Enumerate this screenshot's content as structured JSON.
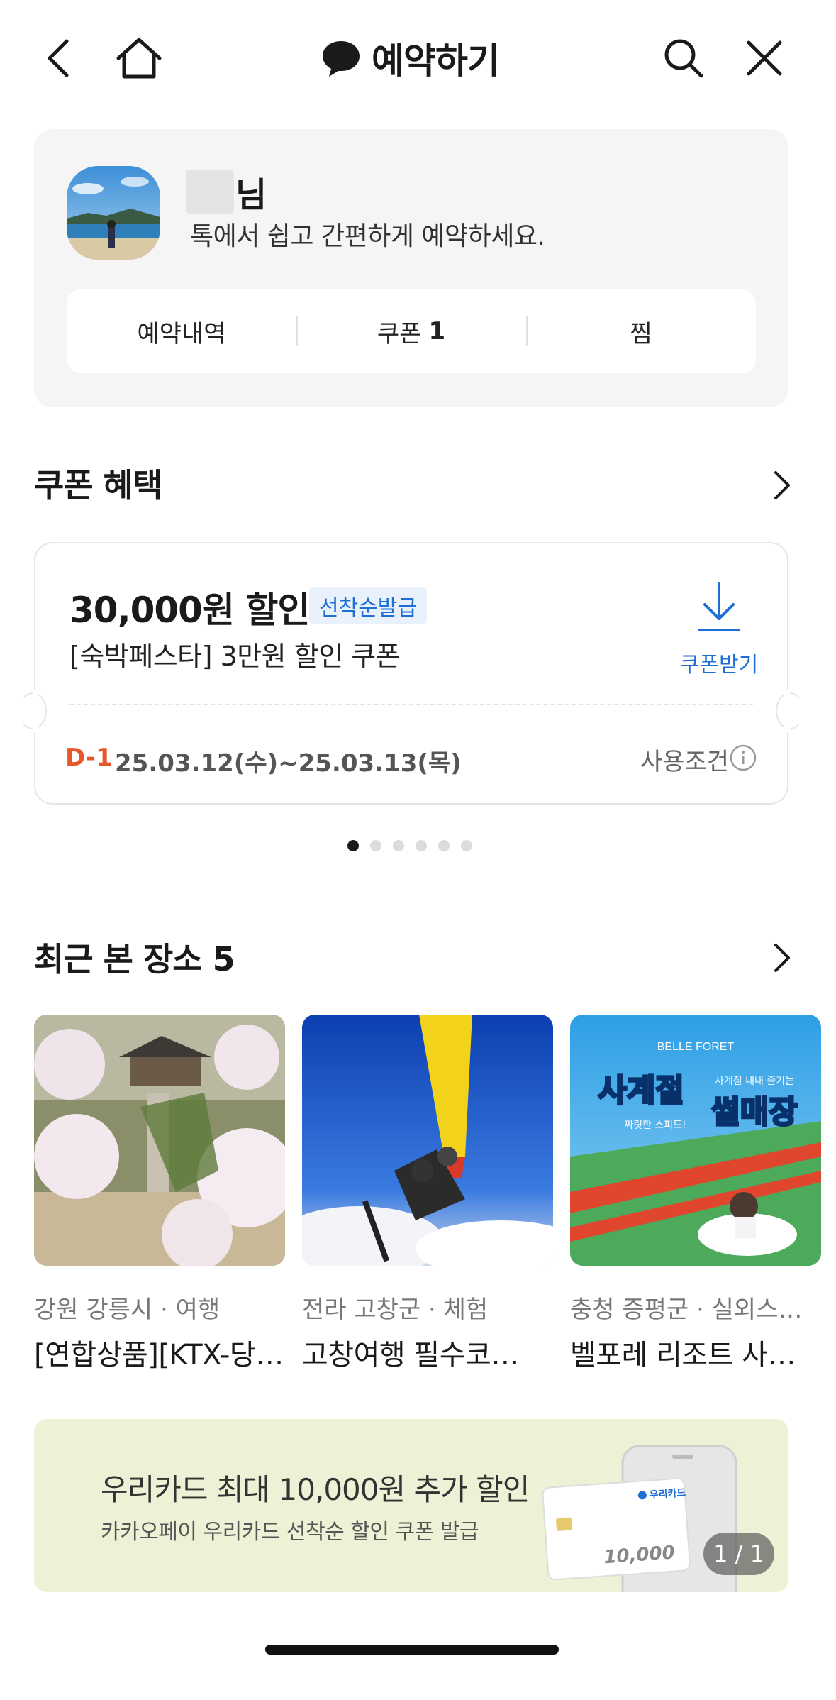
{
  "header": {
    "title": "예약하기",
    "icons": [
      "back-icon",
      "home-icon",
      "chat-bubble-icon",
      "search-icon",
      "close-icon"
    ]
  },
  "profile": {
    "name_suffix": "님",
    "subtitle": "톡에서 쉽고 간편하게 예약하세요.",
    "tabs": [
      {
        "label": "예약내역",
        "count": ""
      },
      {
        "label": "쿠폰",
        "count": "1"
      },
      {
        "label": "찜",
        "count": ""
      }
    ]
  },
  "coupon_section": {
    "title": "쿠폰 혜택",
    "coupon": {
      "amount": "30,000원 할인",
      "badge": "선착순발급",
      "description": "[숙박페스타] 3만원 할인 쿠폰",
      "download_label": "쿠폰받기",
      "dday": "D-1",
      "period": "25.03.12(수)~25.03.13(목)",
      "conditions_label": "사용조건"
    },
    "pager": {
      "total": 6,
      "active": 0
    }
  },
  "recent_section": {
    "title": "최근 본 장소 5",
    "places": [
      {
        "meta": "강원 강릉시 · 여행",
        "name": "[연합상품][KTX-당…"
      },
      {
        "meta": "전라 고창군 · 체험",
        "name": "고창여행 필수코…"
      },
      {
        "meta": "충청 증평군 · 실외스…",
        "name": "벨포레 리조트 사…"
      }
    ],
    "place3_image_text": {
      "brand": "BELLE FORET",
      "headline1": "사계절",
      "headline2": "썰매장",
      "tag1": "사계절 내내 즐기는",
      "tag2": "짜릿한 스피드!"
    }
  },
  "banner": {
    "title": "우리카드 최대 10,000원 추가 할인",
    "subtitle": "카카오페이 우리카드 선착순 할인 쿠폰 발급",
    "card_brand": "우리카드",
    "card_amount": "10,000",
    "page_indicator": "1 / 1"
  },
  "colors": {
    "accent_blue": "#1f6ed4",
    "dday_orange": "#e8572a",
    "banner_bg": "#eef1d6"
  }
}
